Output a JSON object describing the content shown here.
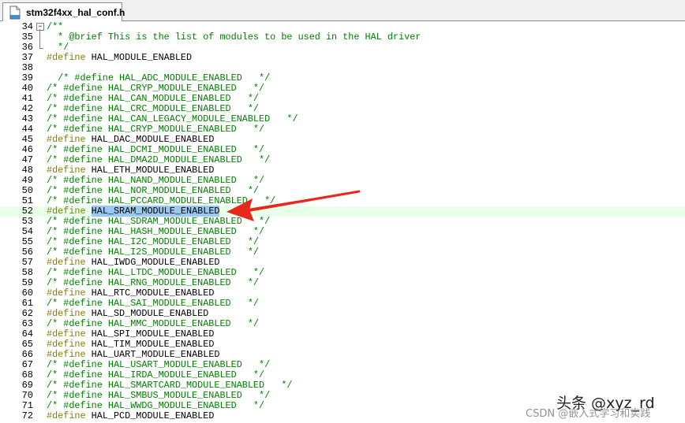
{
  "tab": {
    "filename": "stm32f4xx_hal_conf.h",
    "icon": "file-icon"
  },
  "colors": {
    "comment": "#008000",
    "directive": "#808000",
    "selection": "#99c9ef",
    "current_line": "#e8ffe8",
    "arrow": "#e8281e"
  },
  "lines": [
    {
      "num": "34",
      "type": "comment",
      "code": "/**"
    },
    {
      "num": "35",
      "type": "comment",
      "code": "  * @brief This is the list of modules to be used in the HAL driver"
    },
    {
      "num": "36",
      "type": "comment",
      "code": "  */"
    },
    {
      "num": "37",
      "type": "define",
      "prefix": "",
      "keyword": "#define",
      "name": "HAL_MODULE_ENABLED",
      "suffix": ""
    },
    {
      "num": "38",
      "type": "blank",
      "code": ""
    },
    {
      "num": "39",
      "type": "comment",
      "code": "  /* #define HAL_ADC_MODULE_ENABLED   */"
    },
    {
      "num": "40",
      "type": "comment",
      "code": "/* #define HAL_CRYP_MODULE_ENABLED   */"
    },
    {
      "num": "41",
      "type": "comment",
      "code": "/* #define HAL_CAN_MODULE_ENABLED   */"
    },
    {
      "num": "42",
      "type": "comment",
      "code": "/* #define HAL_CRC_MODULE_ENABLED   */"
    },
    {
      "num": "43",
      "type": "comment",
      "code": "/* #define HAL_CAN_LEGACY_MODULE_ENABLED   */"
    },
    {
      "num": "44",
      "type": "comment",
      "code": "/* #define HAL_CRYP_MODULE_ENABLED   */"
    },
    {
      "num": "45",
      "type": "define",
      "keyword": "#define",
      "name": "HAL_DAC_MODULE_ENABLED"
    },
    {
      "num": "46",
      "type": "comment",
      "code": "/* #define HAL_DCMI_MODULE_ENABLED   */"
    },
    {
      "num": "47",
      "type": "comment",
      "code": "/* #define HAL_DMA2D_MODULE_ENABLED   */"
    },
    {
      "num": "48",
      "type": "define",
      "keyword": "#define",
      "name": "HAL_ETH_MODULE_ENABLED"
    },
    {
      "num": "49",
      "type": "comment",
      "code": "/* #define HAL_NAND_MODULE_ENABLED   */"
    },
    {
      "num": "50",
      "type": "comment",
      "code": "/* #define HAL_NOR_MODULE_ENABLED   */"
    },
    {
      "num": "51",
      "type": "comment",
      "code": "/* #define HAL_PCCARD_MODULE_ENABLED   */"
    },
    {
      "num": "52",
      "type": "define",
      "keyword": "#define",
      "name": "HAL_SRAM_MODULE_ENABLED",
      "selected": true
    },
    {
      "num": "53",
      "type": "comment",
      "code": "/* #define HAL_SDRAM_MODULE_ENABLED   */"
    },
    {
      "num": "54",
      "type": "comment",
      "code": "/* #define HAL_HASH_MODULE_ENABLED   */"
    },
    {
      "num": "55",
      "type": "comment",
      "code": "/* #define HAL_I2C_MODULE_ENABLED   */"
    },
    {
      "num": "56",
      "type": "comment",
      "code": "/* #define HAL_I2S_MODULE_ENABLED   */"
    },
    {
      "num": "57",
      "type": "define",
      "keyword": "#define",
      "name": "HAL_IWDG_MODULE_ENABLED"
    },
    {
      "num": "58",
      "type": "comment",
      "code": "/* #define HAL_LTDC_MODULE_ENABLED   */"
    },
    {
      "num": "59",
      "type": "comment",
      "code": "/* #define HAL_RNG_MODULE_ENABLED   */"
    },
    {
      "num": "60",
      "type": "define",
      "keyword": "#define",
      "name": "HAL_RTC_MODULE_ENABLED"
    },
    {
      "num": "61",
      "type": "comment",
      "code": "/* #define HAL_SAI_MODULE_ENABLED   */"
    },
    {
      "num": "62",
      "type": "define",
      "keyword": "#define",
      "name": "HAL_SD_MODULE_ENABLED"
    },
    {
      "num": "63",
      "type": "comment",
      "code": "/* #define HAL_MMC_MODULE_ENABLED   */"
    },
    {
      "num": "64",
      "type": "define",
      "keyword": "#define",
      "name": "HAL_SPI_MODULE_ENABLED"
    },
    {
      "num": "65",
      "type": "define",
      "keyword": "#define",
      "name": "HAL_TIM_MODULE_ENABLED"
    },
    {
      "num": "66",
      "type": "define",
      "keyword": "#define",
      "name": "HAL_UART_MODULE_ENABLED"
    },
    {
      "num": "67",
      "type": "comment",
      "code": "/* #define HAL_USART_MODULE_ENABLED   */"
    },
    {
      "num": "68",
      "type": "comment",
      "code": "/* #define HAL_IRDA_MODULE_ENABLED   */"
    },
    {
      "num": "69",
      "type": "comment",
      "code": "/* #define HAL_SMARTCARD_MODULE_ENABLED   */"
    },
    {
      "num": "70",
      "type": "comment",
      "code": "/* #define HAL_SMBUS_MODULE_ENABLED   */"
    },
    {
      "num": "71",
      "type": "comment",
      "code": "/* #define HAL_WWDG_MODULE_ENABLED   */"
    },
    {
      "num": "72",
      "type": "define",
      "keyword": "#define",
      "name": "HAL_PCD_MODULE_ENABLED"
    }
  ],
  "watermark": {
    "primary": "头条 @xyz_rd",
    "secondary": "CSDN @嵌入式学习和实践"
  }
}
